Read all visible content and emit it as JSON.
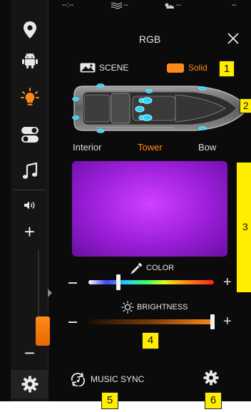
{
  "statusbar": {
    "item1": "--:--",
    "item2": "--",
    "item3": "--",
    "item4": "--"
  },
  "sidebar": {
    "items": [
      {
        "icon": "location-pin-icon",
        "active": false
      },
      {
        "icon": "android-icon",
        "active": false
      },
      {
        "icon": "lightbulb-icon",
        "active": true
      },
      {
        "icon": "toggle-switch-icon",
        "active": false
      },
      {
        "icon": "music-note-icon",
        "active": false
      }
    ],
    "volume": {
      "plus": "+",
      "minus": "−",
      "level": 0.2
    },
    "settings_icon": "gear-icon"
  },
  "header": {
    "title": "RGB",
    "close_icon": "close-icon"
  },
  "mode": {
    "scene_label": "SCENE",
    "solid_label": "Solid",
    "selected": "Solid"
  },
  "zones": {
    "tabs": [
      "Interior",
      "Tower",
      "Bow"
    ],
    "selected": "Tower"
  },
  "color_slider": {
    "label": "COLOR",
    "minus": "−",
    "plus": "+",
    "position": 0.24
  },
  "brightness_slider": {
    "label": "BRIGHTNESS",
    "minus": "−",
    "plus": "+",
    "position": 0.99
  },
  "music_sync": {
    "label": "MUSIC SYNC"
  },
  "markers": [
    "1",
    "2",
    "3",
    "4",
    "5",
    "6"
  ],
  "colors": {
    "accent": "#ff8a1a",
    "marker": "#ffee00",
    "preview": "#b030f0"
  }
}
